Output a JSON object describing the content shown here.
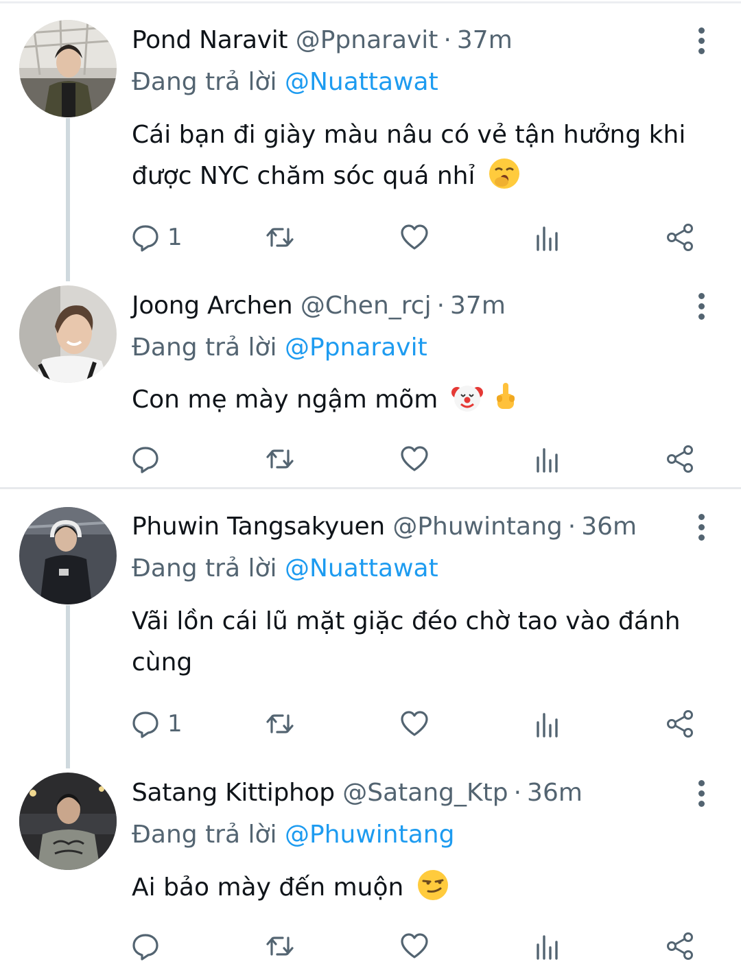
{
  "tweets": [
    {
      "name": "Pond Naravit",
      "handle": "@Ppnaravit",
      "time": "37m",
      "reply_prefix": "Đang trả lời",
      "reply_to": "@Nuattawat",
      "text": "Cái bạn đi giày màu nâu có vẻ tận hưởng khi được NYC chăm sóc quá nhỉ",
      "emojis": [
        "yawning-face"
      ],
      "reply_count": "1"
    },
    {
      "name": "Joong Archen",
      "handle": "@Chen_rcj",
      "time": "37m",
      "reply_prefix": "Đang trả lời",
      "reply_to": "@Ppnaravit",
      "text": "Con mẹ mày ngậm mõm",
      "emojis": [
        "clown-face",
        "middle-finger"
      ],
      "reply_count": ""
    },
    {
      "name": "Phuwin Tangsakyuen",
      "handle": "@Phuwintang",
      "time": "36m",
      "reply_prefix": "Đang trả lời",
      "reply_to": "@Nuattawat",
      "text": "Vãi lồn cái lũ mặt giặc đéo chờ tao vào đánh cùng",
      "emojis": [],
      "reply_count": "1"
    },
    {
      "name": "Satang Kittiphop",
      "handle": "@Satang_Ktp",
      "time": "36m",
      "reply_prefix": "Đang trả lời",
      "reply_to": "@Phuwintang",
      "text": "Ai bảo mày đến muộn",
      "emojis": [
        "smirking-face"
      ],
      "reply_count": ""
    }
  ],
  "separator": "·",
  "icons": [
    "reply-icon",
    "retweet-icon",
    "like-icon",
    "views-icon",
    "share-icon",
    "more-icon"
  ],
  "colors": {
    "text": "#0f1419",
    "secondary": "#536471",
    "mention": "#1d9bf0",
    "thread_line": "#cfd9de"
  }
}
